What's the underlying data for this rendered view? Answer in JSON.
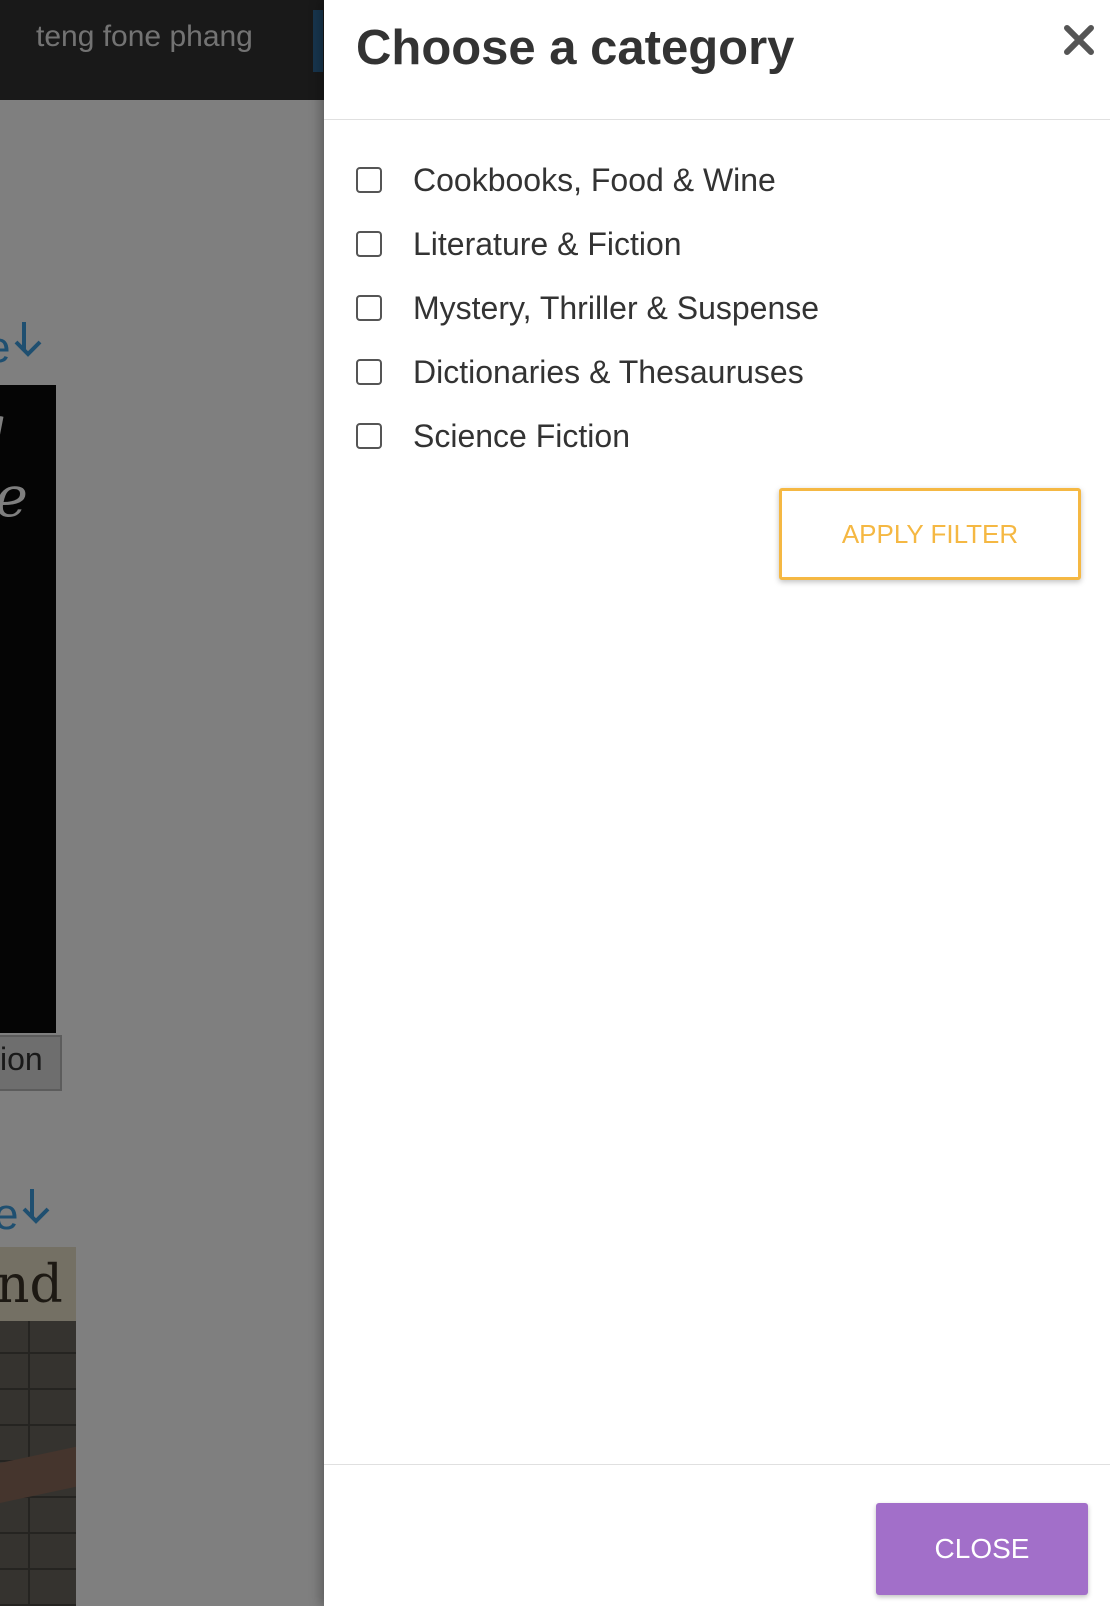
{
  "background": {
    "user_name": "teng fone phang",
    "more_link_1": "e",
    "more_link_2": "e",
    "book1_cover_line1": "g",
    "book1_cover_line2": "se",
    "book1_label": "ion",
    "book2_title": "nd"
  },
  "modal": {
    "title": "Choose a category",
    "categories": [
      {
        "label": "Cookbooks, Food & Wine",
        "checked": false
      },
      {
        "label": "Literature & Fiction",
        "checked": false
      },
      {
        "label": "Mystery, Thriller & Suspense",
        "checked": false
      },
      {
        "label": "Dictionaries & Thesauruses",
        "checked": false
      },
      {
        "label": "Science Fiction",
        "checked": false
      }
    ],
    "apply_label": "APPLY FILTER",
    "close_label": "CLOSE"
  },
  "colors": {
    "apply_accent": "#f5b843",
    "close_button": "#a26fc9",
    "topbar": "#333333",
    "link_blue": "#3f9fe0"
  },
  "icons": {
    "close": "close-icon",
    "more_arrow": "arrow-down-icon"
  }
}
